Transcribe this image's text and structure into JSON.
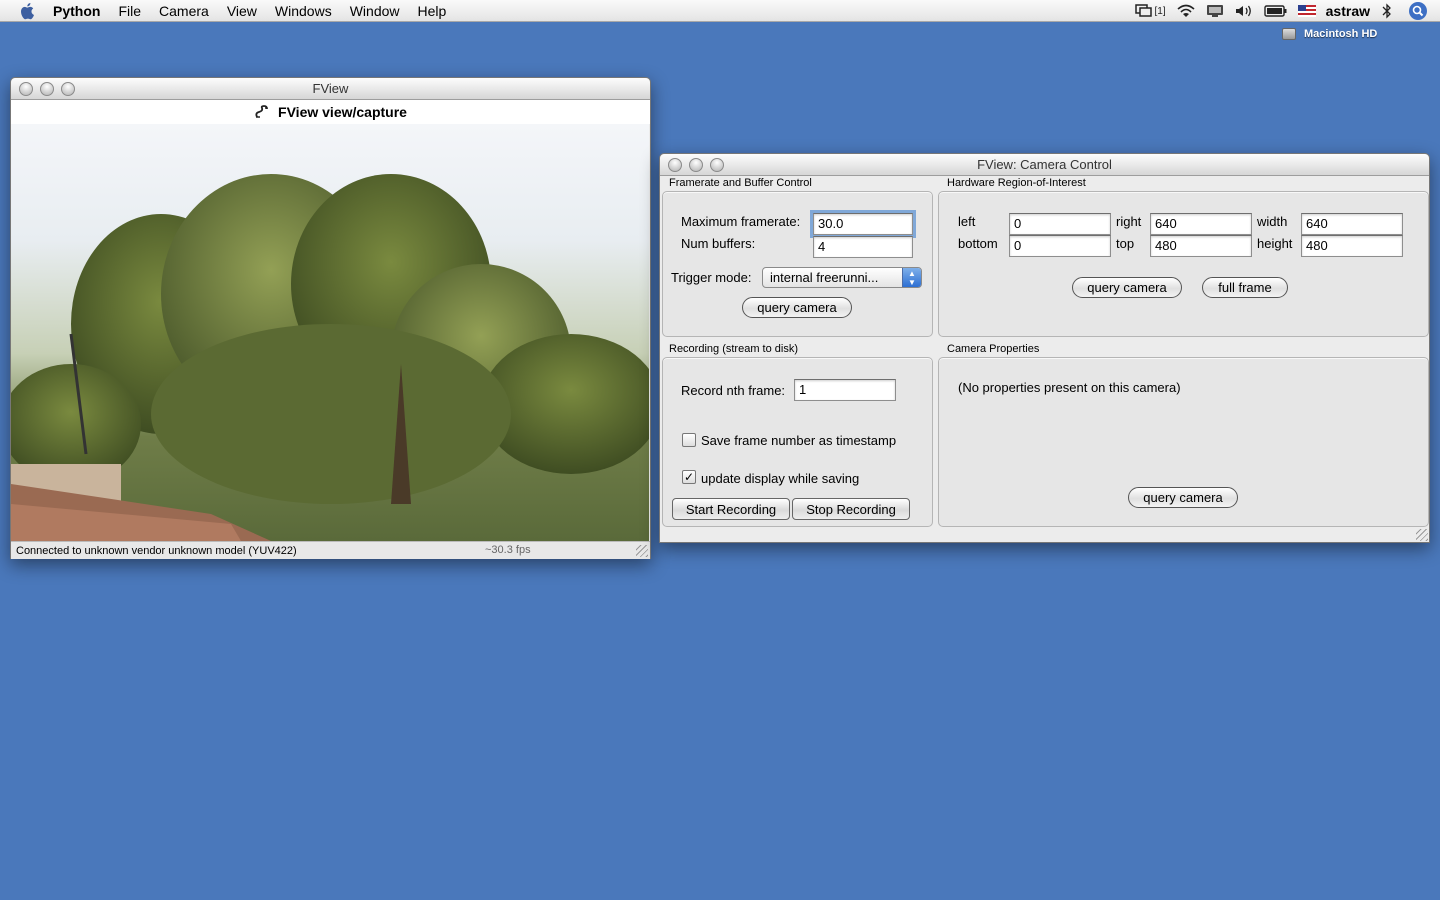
{
  "menubar": {
    "app_name": "Python",
    "items": [
      "File",
      "Camera",
      "View",
      "Windows",
      "Window",
      "Help"
    ],
    "status_tag": "[1]",
    "user": "astraw"
  },
  "desktop": {
    "disk_label": "Macintosh HD"
  },
  "fview_window": {
    "title": "FView",
    "subtitle": "FView view/capture",
    "status": "Connected to unknown vendor unknown model (YUV422)",
    "fps": "~30.3 fps"
  },
  "control_window": {
    "title": "FView: Camera Control",
    "framerate": {
      "group_label": "Framerate and Buffer Control",
      "max_framerate_label": "Maximum framerate:",
      "max_framerate_value": "30.0",
      "num_buffers_label": "Num buffers:",
      "num_buffers_value": "4",
      "trigger_label": "Trigger mode:",
      "trigger_value": "internal freerunni...",
      "query_button": "query camera"
    },
    "roi": {
      "group_label": "Hardware Region-of-Interest",
      "left_label": "left",
      "left_value": "0",
      "right_label": "right",
      "right_value": "640",
      "width_label": "width",
      "width_value": "640",
      "bottom_label": "bottom",
      "bottom_value": "0",
      "top_label": "top",
      "top_value": "480",
      "height_label": "height",
      "height_value": "480",
      "query_button": "query camera",
      "full_frame_button": "full frame"
    },
    "recording": {
      "group_label": "Recording (stream to disk)",
      "nth_frame_label": "Record nth frame:",
      "nth_frame_value": "1",
      "timestamp_label": "Save frame number as timestamp",
      "timestamp_checked": false,
      "update_display_label": "update display while saving",
      "update_display_checked": true,
      "start_button": "Start Recording",
      "stop_button": "Stop Recording"
    },
    "properties": {
      "group_label": "Camera Properties",
      "empty_message": "(No properties present on this camera)",
      "query_button": "query camera"
    }
  }
}
